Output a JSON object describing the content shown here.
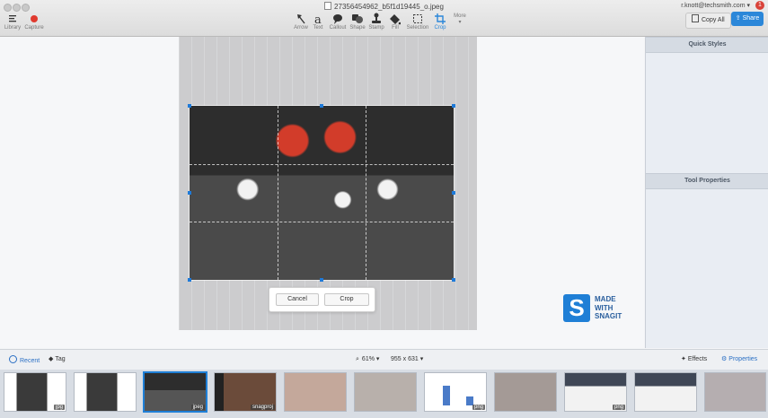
{
  "window": {
    "title": "27356454962_b5f1d19445_o.jpeg",
    "account": "r.knott@techsmith.com ▾",
    "notification_count": "1"
  },
  "toolbar": {
    "left": [
      {
        "key": "library",
        "label": "Library",
        "icon": "hamburger-icon"
      },
      {
        "key": "capture",
        "label": "Capture",
        "icon": "record-icon"
      }
    ],
    "tools": [
      {
        "key": "arrow",
        "label": "Arrow",
        "icon": "arrow-icon"
      },
      {
        "key": "text",
        "label": "Text",
        "icon": "text-a-icon"
      },
      {
        "key": "callout",
        "label": "Callout",
        "icon": "speech-bubble-icon"
      },
      {
        "key": "shape",
        "label": "Shape",
        "icon": "shapes-icon"
      },
      {
        "key": "stamp",
        "label": "Stamp",
        "icon": "stamp-icon"
      },
      {
        "key": "fill",
        "label": "Fill",
        "icon": "paint-bucket-icon"
      },
      {
        "key": "selection",
        "label": "Selection",
        "icon": "selection-icon"
      },
      {
        "key": "crop",
        "label": "Crop",
        "icon": "crop-icon"
      }
    ],
    "more_label": "More",
    "copy_all_label": "Copy All",
    "share_label": "Share"
  },
  "crop_dialog": {
    "cancel_label": "Cancel",
    "crop_label": "Crop"
  },
  "watermark": {
    "line1": "MADE",
    "line2": "WITH",
    "line3": "SNAGIT"
  },
  "panel": {
    "quick_styles": "Quick Styles",
    "tool_properties": "Tool Properties"
  },
  "bottombar": {
    "recent_label": "Recent",
    "tag_label": "Tag",
    "zoom": "61% ▾",
    "dimensions": "955 x 631 ▾",
    "effects_label": "Effects",
    "properties_label": "Properties"
  },
  "tray": {
    "thumbnails": [
      {
        "badge": "jpg",
        "selected": false
      },
      {
        "badge": "",
        "selected": false
      },
      {
        "badge": "jpeg",
        "selected": true
      },
      {
        "badge": "snagproj",
        "selected": false
      },
      {
        "badge": "",
        "selected": false
      },
      {
        "badge": "",
        "selected": false
      },
      {
        "badge": "png",
        "selected": false
      },
      {
        "badge": "",
        "selected": false
      },
      {
        "badge": "png",
        "selected": false
      },
      {
        "badge": "",
        "selected": false
      },
      {
        "badge": "",
        "selected": false
      }
    ]
  },
  "colors": {
    "accent": "#1f7fd6",
    "record": "#e03a2f"
  }
}
